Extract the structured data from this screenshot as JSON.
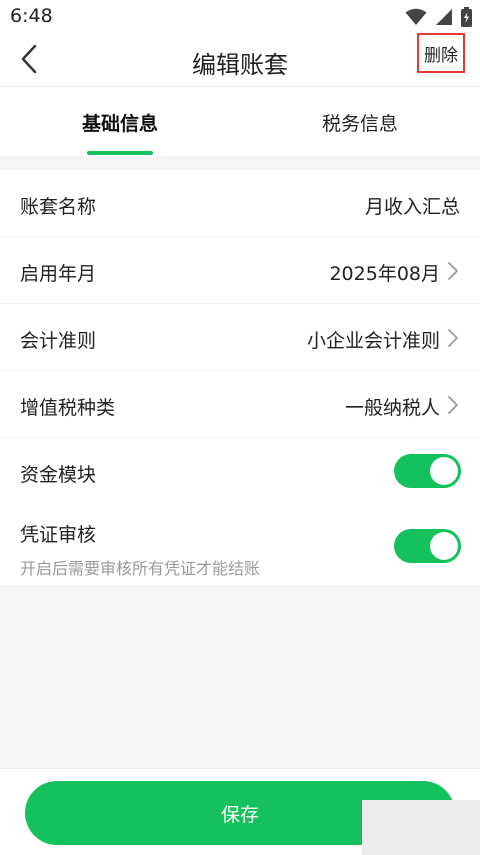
{
  "status_bar": {
    "time": "6:48",
    "icons": [
      "wifi-icon",
      "signal-icon",
      "battery-icon"
    ]
  },
  "nav": {
    "title": "编辑账套",
    "back_icon": "chevron-left-icon",
    "delete_label": "删除"
  },
  "tabs": [
    {
      "label": "基础信息",
      "active": true
    },
    {
      "label": "税务信息",
      "active": false
    }
  ],
  "form": {
    "account_name": {
      "label": "账套名称",
      "value": "月收入汇总"
    },
    "start_month": {
      "label": "启用年月",
      "value": "2025年08月"
    },
    "accounting_standard": {
      "label": "会计准则",
      "value": "小企业会计准则"
    },
    "vat_type": {
      "label": "增值税种类",
      "value": "一般纳税人"
    },
    "fund_module": {
      "label": "资金模块",
      "enabled": true
    },
    "voucher_review": {
      "label": "凭证审核",
      "description": "开启后需要审核所有凭证才能结账",
      "enabled": true
    }
  },
  "save_label": "保存",
  "colors": {
    "accent": "#15c15d",
    "delete_highlight": "#e53935",
    "background": "#f5f5f5"
  }
}
